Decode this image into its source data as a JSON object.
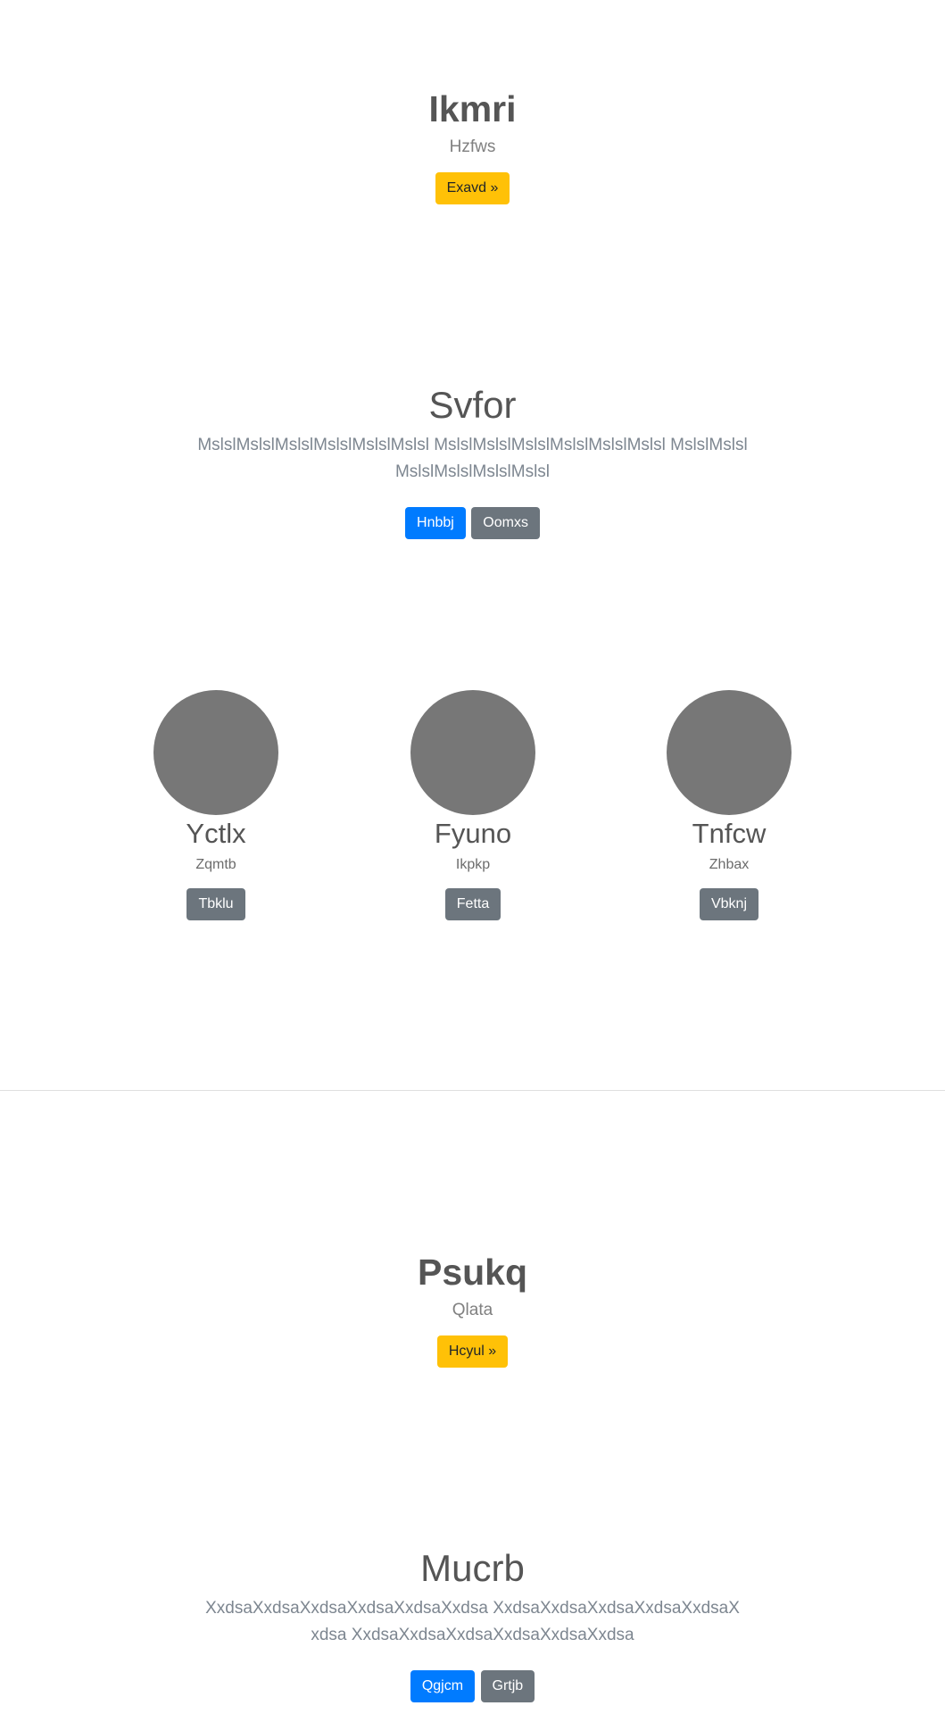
{
  "hero1": {
    "title": "Ikmri",
    "subtitle": "Hzfws",
    "button": "Exavd »"
  },
  "section1": {
    "title": "Svfor",
    "text": "MslslMslslMslslMslslMslslMslsl MslslMslslMslslMslslMslslMslsl MslslMslslMslslMslslMslslMslsl",
    "primary_button": "Hnbbj",
    "secondary_button": "Oomxs"
  },
  "cards": [
    {
      "title": "Yctlx",
      "subtitle": "Zqmtb",
      "button": "Tbklu"
    },
    {
      "title": "Fyuno",
      "subtitle": "Ikpkp",
      "button": "Fetta"
    },
    {
      "title": "Tnfcw",
      "subtitle": "Zhbax",
      "button": "Vbknj"
    }
  ],
  "hero2": {
    "title": "Psukq",
    "subtitle": "Qlata",
    "button": "Hcyul »"
  },
  "section2": {
    "title": "Mucrb",
    "text": "XxdsaXxdsaXxdsaXxdsaXxdsaXxdsa XxdsaXxdsaXxdsaXxdsaXxdsaXxdsa XxdsaXxdsaXxdsaXxdsaXxdsaXxdsa",
    "primary_button": "Qgjcm",
    "secondary_button": "Grtjb"
  },
  "colors": {
    "warning": "#ffc107",
    "primary": "#007bff",
    "secondary": "#6c757d",
    "avatar": "#777777"
  }
}
